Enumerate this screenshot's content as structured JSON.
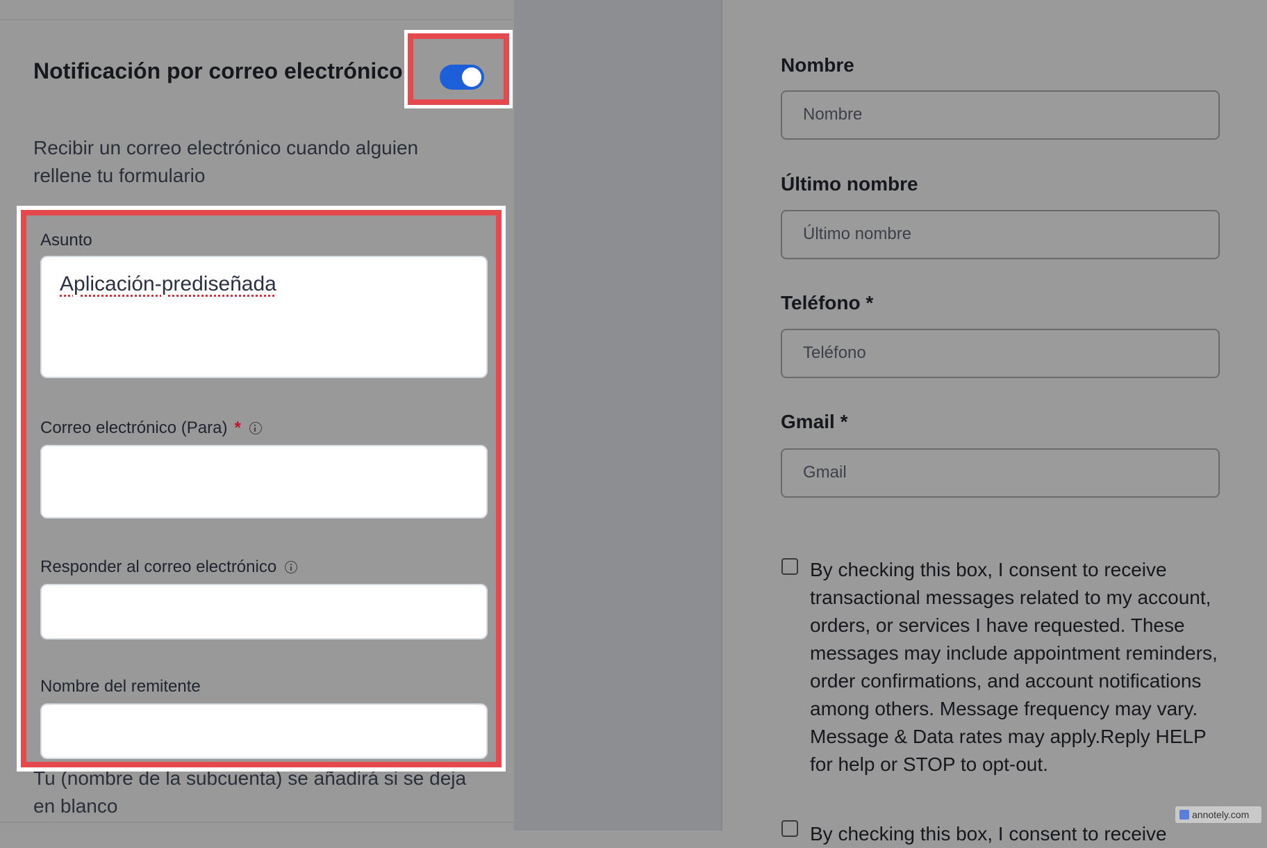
{
  "email_notification": {
    "title": "Notificación por correo electrónico",
    "toggle_on": true,
    "description": "Recibir un correo electrónico cuando alguien rellene tu formulario",
    "fields": {
      "subject": {
        "label": "Asunto",
        "value": "Aplicación-prediseñada"
      },
      "email_to": {
        "label": "Correo electrónico (Para)",
        "required_mark": "*",
        "value": ""
      },
      "reply_to": {
        "label": "Responder al correo electrónico",
        "value": ""
      },
      "sender_name": {
        "label": "Nombre del remitente",
        "value": ""
      }
    },
    "sender_note": "Tu (nombre de la subcuenta) se añadirá si se deja en blanco"
  },
  "form_preview": {
    "fields": [
      {
        "label": "Nombre",
        "placeholder": "Nombre"
      },
      {
        "label": "Último nombre",
        "placeholder": "Último nombre"
      },
      {
        "label": "Teléfono *",
        "placeholder": "Teléfono"
      },
      {
        "label": "Gmail *",
        "placeholder": "Gmail"
      }
    ],
    "consent_text": "By checking this box, I consent to receive transactional messages related to my account, orders, or services I have requested. These messages may include appointment reminders, order confirmations, and account notifications among others. Message frequency may vary. Message & Data rates may apply.Reply HELP for help or STOP to opt-out.",
    "consent_text_2": "By checking this box, I consent to receive"
  },
  "watermark": "annotely.com",
  "colors": {
    "toggle": "#1d5fd9",
    "annotation": "#e5484d",
    "required": "#c8102e"
  }
}
